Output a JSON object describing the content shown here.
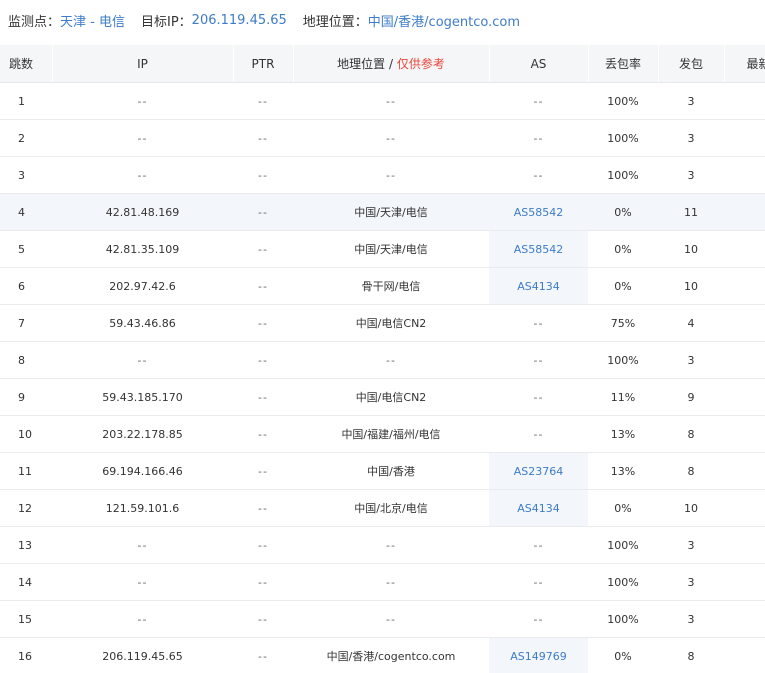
{
  "info": {
    "monitor_label": "监测点：",
    "monitor_value": "天津 - 电信",
    "target_label": "目标IP：",
    "target_value": "206.119.45.65",
    "geo_label": "地理位置：",
    "geo_value": "中国/香港/cogentco.com"
  },
  "table": {
    "headers": {
      "hop": "跳数",
      "ip": "IP",
      "ptr": "PTR",
      "geo": "地理位置",
      "geo_slash": " / ",
      "geo_note": "仅供参考",
      "as": "AS",
      "loss": "丢包率",
      "sent": "发包",
      "last": "最新"
    },
    "rows": [
      {
        "hop": "1",
        "ip": "--",
        "ptr": "--",
        "geo": "--",
        "as": "--",
        "loss": "100%",
        "sent": "3"
      },
      {
        "hop": "2",
        "ip": "--",
        "ptr": "--",
        "geo": "--",
        "as": "--",
        "loss": "100%",
        "sent": "3"
      },
      {
        "hop": "3",
        "ip": "--",
        "ptr": "--",
        "geo": "--",
        "as": "--",
        "loss": "100%",
        "sent": "3"
      },
      {
        "hop": "4",
        "ip": "42.81.48.169",
        "ptr": "--",
        "geo": "中国/天津/电信",
        "as": "AS58542",
        "loss": "0%",
        "sent": "11"
      },
      {
        "hop": "5",
        "ip": "42.81.35.109",
        "ptr": "--",
        "geo": "中国/天津/电信",
        "as": "AS58542",
        "loss": "0%",
        "sent": "10"
      },
      {
        "hop": "6",
        "ip": "202.97.42.6",
        "ptr": "--",
        "geo": "骨干网/电信",
        "as": "AS4134",
        "loss": "0%",
        "sent": "10"
      },
      {
        "hop": "7",
        "ip": "59.43.46.86",
        "ptr": "--",
        "geo": "中国/电信CN2",
        "as": "--",
        "loss": "75%",
        "sent": "4"
      },
      {
        "hop": "8",
        "ip": "--",
        "ptr": "--",
        "geo": "--",
        "as": "--",
        "loss": "100%",
        "sent": "3"
      },
      {
        "hop": "9",
        "ip": "59.43.185.170",
        "ptr": "--",
        "geo": "中国/电信CN2",
        "as": "--",
        "loss": "11%",
        "sent": "9"
      },
      {
        "hop": "10",
        "ip": "203.22.178.85",
        "ptr": "--",
        "geo": "中国/福建/福州/电信",
        "as": "--",
        "loss": "13%",
        "sent": "8"
      },
      {
        "hop": "11",
        "ip": "69.194.166.46",
        "ptr": "--",
        "geo": "中国/香港",
        "as": "AS23764",
        "loss": "13%",
        "sent": "8"
      },
      {
        "hop": "12",
        "ip": "121.59.101.6",
        "ptr": "--",
        "geo": "中国/北京/电信",
        "as": "AS4134",
        "loss": "0%",
        "sent": "10"
      },
      {
        "hop": "13",
        "ip": "--",
        "ptr": "--",
        "geo": "--",
        "as": "--",
        "loss": "100%",
        "sent": "3"
      },
      {
        "hop": "14",
        "ip": "--",
        "ptr": "--",
        "geo": "--",
        "as": "--",
        "loss": "100%",
        "sent": "3"
      },
      {
        "hop": "15",
        "ip": "--",
        "ptr": "--",
        "geo": "--",
        "as": "--",
        "loss": "100%",
        "sent": "3"
      },
      {
        "hop": "16",
        "ip": "206.119.45.65",
        "ptr": "--",
        "geo": "中国/香港/cogentco.com",
        "as": "AS149769",
        "loss": "0%",
        "sent": "8"
      }
    ],
    "highlighted_hop": "4"
  },
  "colors": {
    "link": "#3d7cc9",
    "note": "#e8463a",
    "header_bg": "#f5f6f8",
    "highlight_bg": "#f3f6fb"
  }
}
